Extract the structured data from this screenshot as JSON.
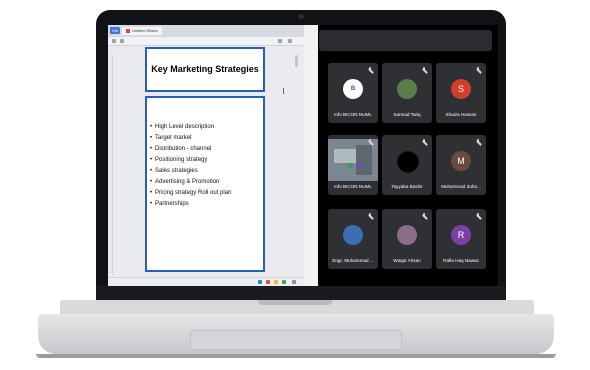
{
  "slide_viewer": {
    "home_tab": "Hm",
    "doc_tab": "Untitled Slides",
    "slide_title": "Key Marketing Strategies",
    "bullets": [
      "High Level description",
      "Target market",
      "Distribution - channel",
      "Positioning strategy",
      "Sales strategies",
      "Advertising & Promotion",
      "Pricing strategy Roll out plan",
      "Partnerships"
    ]
  },
  "meeting": {
    "participants": [
      {
        "name": "Info BICON NUML",
        "initial": "",
        "avatar_color": "#ffffff",
        "kind": "logo"
      },
      {
        "name": "Sarmad Tariq",
        "initial": "",
        "avatar_color": "#5a7d4a",
        "kind": "photo"
      },
      {
        "name": "Shaiza Hassan",
        "initial": "S",
        "avatar_color": "#d13f2a",
        "kind": "letter"
      },
      {
        "name": "Info BICON NUML",
        "initial": "",
        "avatar_color": "#7a8790",
        "kind": "video"
      },
      {
        "name": "Tayyaba Bashir",
        "initial": "",
        "avatar_color": "#000000",
        "kind": "dark"
      },
      {
        "name": "Muhammad Zuho...",
        "initial": "M",
        "avatar_color": "#6b4a3e",
        "kind": "letter"
      },
      {
        "name": "Engr. Muhammad ...",
        "initial": "",
        "avatar_color": "#3b6fb0",
        "kind": "photo"
      },
      {
        "name": "Waqar Ahsan",
        "initial": "",
        "avatar_color": "#8c6d8a",
        "kind": "photo"
      },
      {
        "name": "Rafia Haq Nawaz",
        "initial": "R",
        "avatar_color": "#7b3fa6",
        "kind": "letter"
      }
    ]
  }
}
